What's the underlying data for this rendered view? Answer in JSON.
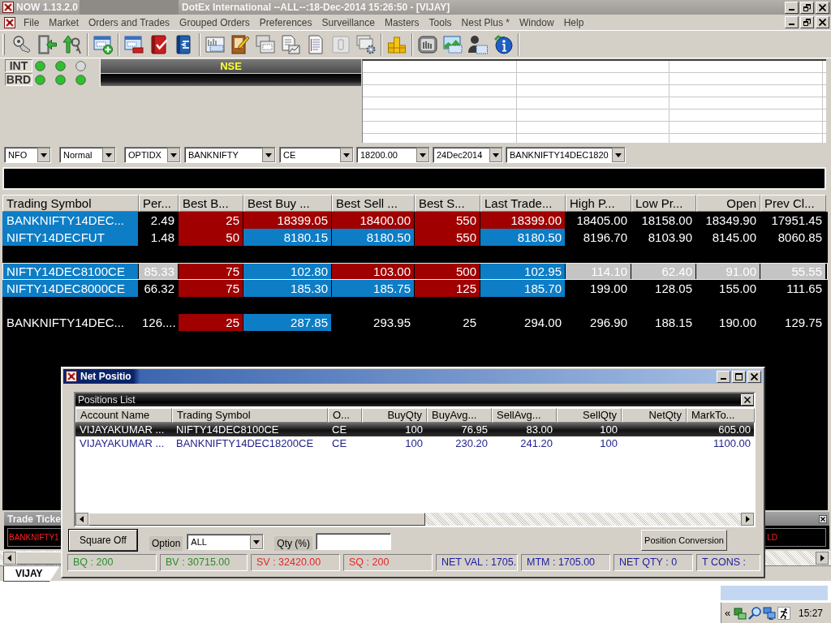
{
  "window": {
    "title": "NOW 1.13.2.0",
    "subtitle": "DotEx International --ALL--:18-Dec-2014 15:26:50 - [VIJAY]"
  },
  "menu": [
    "File",
    "Market",
    "Orders and Trades",
    "Grouped Orders",
    "Preferences",
    "Surveillance",
    "Masters",
    "Tools",
    "Nest Plus *",
    "Window",
    "Help"
  ],
  "connection_status": {
    "exchange": "NSE",
    "rows": [
      {
        "label": "INT",
        "leds": [
          {
            "color": "#2fbf2f"
          },
          {
            "color": "#2fbf2f"
          },
          {
            "color": "#d9d9d9"
          }
        ]
      },
      {
        "label": "BRD",
        "leds": [
          {
            "color": "#2fbf2f"
          },
          {
            "color": "#2fbf2f"
          },
          {
            "color": "#2fbf2f"
          }
        ]
      }
    ]
  },
  "filters": [
    "NFO",
    "Normal",
    "OPTIDX",
    "BANKNIFTY",
    "CE",
    "18200.00",
    "24Dec2014",
    "BANKNIFTY14DEC1820"
  ],
  "market_watch": {
    "columns": [
      "Trading Symbol",
      "Per...",
      "Best B...",
      "Best Buy ...",
      "Best Sell ...",
      "Best S...",
      "Last Trade...",
      "High P...",
      "Low Pr...",
      "Open",
      "Prev Cl..."
    ],
    "rows": [
      {
        "kind": "quote",
        "selected": false,
        "cells": [
          {
            "text": "BANKNIFTY14DEC...",
            "color": "#0d7dc6"
          },
          {
            "text": "2.49"
          },
          {
            "text": "25",
            "color": "#a00000"
          },
          {
            "text": "18399.05",
            "color": "#a00000"
          },
          {
            "text": "18400.00",
            "color": "#a00000"
          },
          {
            "text": "550",
            "color": "#a00000"
          },
          {
            "text": "18399.00",
            "color": "#a00000"
          },
          {
            "text": "18405.00"
          },
          {
            "text": "18158.00"
          },
          {
            "text": "18349.90"
          },
          {
            "text": "17951.45"
          }
        ]
      },
      {
        "kind": "quote",
        "selected": false,
        "cells": [
          {
            "text": "NIFTY14DECFUT",
            "color": "#0d7dc6"
          },
          {
            "text": "1.48"
          },
          {
            "text": "50",
            "color": "#a00000"
          },
          {
            "text": "8180.15",
            "color": "#0d7dc6"
          },
          {
            "text": "8180.50",
            "color": "#0d7dc6"
          },
          {
            "text": "550",
            "color": "#a00000"
          },
          {
            "text": "8180.50",
            "color": "#0d7dc6"
          },
          {
            "text": "8196.70"
          },
          {
            "text": "8103.90"
          },
          {
            "text": "8145.00"
          },
          {
            "text": "8060.85"
          }
        ]
      },
      {
        "kind": "blank"
      },
      {
        "kind": "quote",
        "selected": true,
        "cells": [
          {
            "text": "NIFTY14DEC8100CE",
            "color": "#0d7dc6"
          },
          {
            "text": "85.33"
          },
          {
            "text": "75",
            "color": "#a00000"
          },
          {
            "text": "102.80",
            "color": "#0d7dc6"
          },
          {
            "text": "103.00",
            "color": "#a00000"
          },
          {
            "text": "500",
            "color": "#a00000"
          },
          {
            "text": "102.95",
            "color": "#0d7dc6"
          },
          {
            "text": "114.10"
          },
          {
            "text": "62.40"
          },
          {
            "text": "91.00"
          },
          {
            "text": "55.55"
          }
        ]
      },
      {
        "kind": "quote",
        "selected": false,
        "cells": [
          {
            "text": "NIFTY14DEC8000CE",
            "color": "#0d7dc6"
          },
          {
            "text": "66.32"
          },
          {
            "text": "75",
            "color": "#a00000"
          },
          {
            "text": "185.30",
            "color": "#0d7dc6"
          },
          {
            "text": "185.75",
            "color": "#0d7dc6"
          },
          {
            "text": "125",
            "color": "#a00000"
          },
          {
            "text": "185.70",
            "color": "#0d7dc6"
          },
          {
            "text": "199.00"
          },
          {
            "text": "128.05"
          },
          {
            "text": "155.00"
          },
          {
            "text": "111.65"
          }
        ]
      },
      {
        "kind": "blank"
      },
      {
        "kind": "quote",
        "selected": false,
        "cells": [
          {
            "text": "BANKNIFTY14DEC..."
          },
          {
            "text": "126...."
          },
          {
            "text": "25",
            "color": "#a00000"
          },
          {
            "text": "287.85",
            "color": "#0d7dc6"
          },
          {
            "text": "293.95"
          },
          {
            "text": "25"
          },
          {
            "text": "294.00"
          },
          {
            "text": "296.90"
          },
          {
            "text": "188.15"
          },
          {
            "text": "190.00"
          },
          {
            "text": "129.75"
          }
        ]
      }
    ]
  },
  "trade_ticker": {
    "title": "Trade Ticke",
    "items": [
      "BANKNIFTY1",
      "LD"
    ]
  },
  "sheet_tabs": [
    {
      "label": "VIJAY",
      "selected": true
    }
  ],
  "net_position": {
    "title": "Net Positio",
    "panel_title": "Positions List",
    "columns": [
      "Account Name",
      "Trading Symbol",
      "O...",
      "BuyQty",
      "BuyAvg...",
      "SellAvg...",
      "SellQty",
      "NetQty",
      "MarkTo..."
    ],
    "rows": [
      {
        "selected": true,
        "cells": [
          "VIJAYAKUMAR ...",
          "NIFTY14DEC8100CE",
          "CE",
          "100",
          "76.95",
          "83.00",
          "100",
          null,
          "605.00"
        ]
      },
      {
        "selected": false,
        "cells": [
          "VIJAYAKUMAR ...",
          "BANKNIFTY14DEC18200CE",
          "CE",
          "100",
          "230.20",
          "241.20",
          "100",
          null,
          "1100.00"
        ]
      }
    ],
    "square_off_button": "Square Off",
    "option": {
      "label": "Option",
      "value": "ALL"
    },
    "qty": {
      "label": "Qty (%)"
    },
    "conversion_button": "Position Conversion",
    "summary": [
      {
        "text": "BQ : 200",
        "color": "#2e8b2e"
      },
      {
        "text": "BV : 30715.00",
        "color": "#2e8b2e"
      },
      {
        "text": "SV : 32420.00",
        "color": "#e02828"
      },
      {
        "text": "SQ : 200",
        "color": "#e02828"
      },
      {
        "text": "NET VAL : 1705.",
        "color": "#1c1ca0"
      },
      {
        "text": "MTM : 1705.00",
        "color": "#1c1ca0"
      },
      {
        "text": "NET QTY : 0",
        "color": "#1c1ca0"
      },
      {
        "text": "T CONS :",
        "color": "#1c1ca0"
      }
    ]
  },
  "tray": {
    "chevron": "«",
    "time": "15:27"
  }
}
